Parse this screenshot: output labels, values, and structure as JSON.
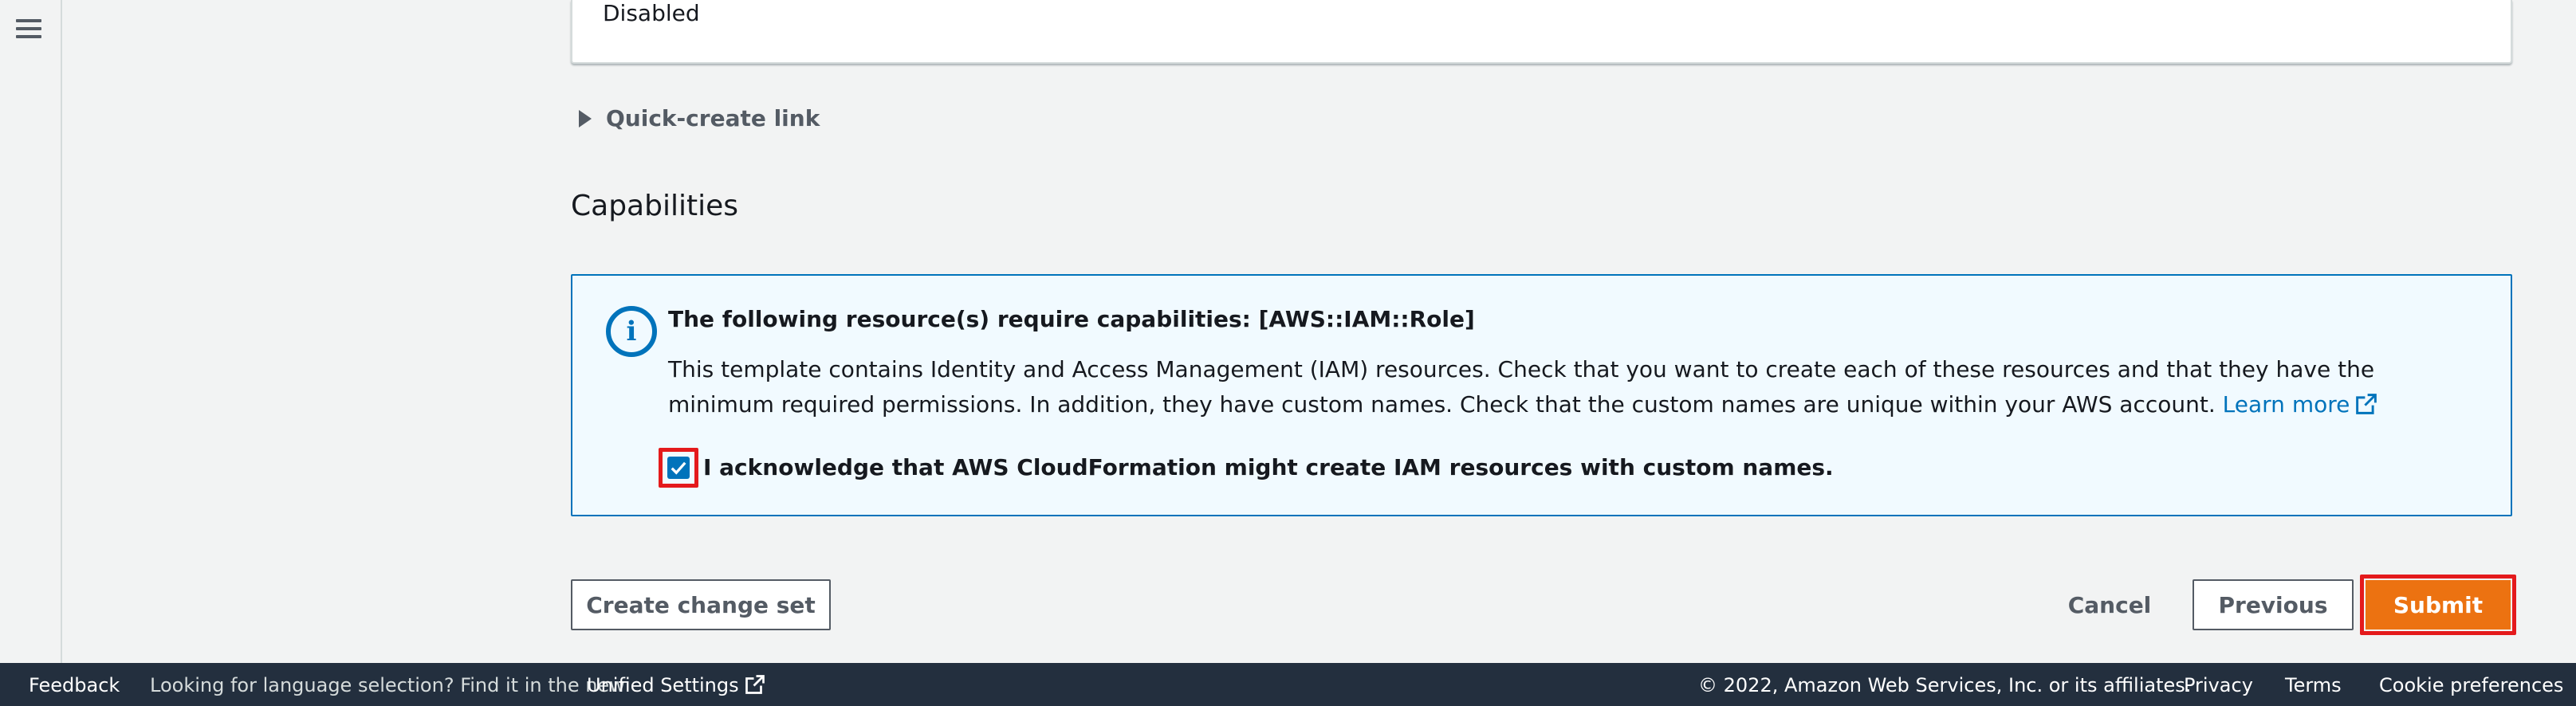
{
  "top_panel": {
    "value": "Disabled"
  },
  "expander": {
    "label": "Quick-create link"
  },
  "capabilities": {
    "title": "Capabilities",
    "alert": {
      "title": "The following resource(s) require capabilities: [AWS::IAM::Role]",
      "body_line1": "This template contains Identity and Access Management (IAM) resources. Check that you want to create each of these resources and that they have the minimum required",
      "body_line2": "permissions. In addition, they have custom names. Check that the custom names are unique within your AWS account.",
      "learn_more": "Learn more",
      "acknowledge_label": "I acknowledge that AWS CloudFormation might create IAM resources with custom names.",
      "acknowledge_checked": true
    }
  },
  "actions": {
    "create_change_set": "Create change set",
    "cancel": "Cancel",
    "previous": "Previous",
    "submit": "Submit"
  },
  "footer": {
    "feedback": "Feedback",
    "language_prompt": "Looking for language selection? Find it in the new",
    "unified_settings": "Unified Settings",
    "copyright": "© 2022, Amazon Web Services, Inc. or its affiliates.",
    "privacy": "Privacy",
    "terms": "Terms",
    "cookie_preferences": "Cookie preferences"
  },
  "colors": {
    "primary_button": "#ec7211",
    "link": "#0073bb",
    "highlight": "#e41a1c",
    "footer_bg": "#232f3e"
  }
}
